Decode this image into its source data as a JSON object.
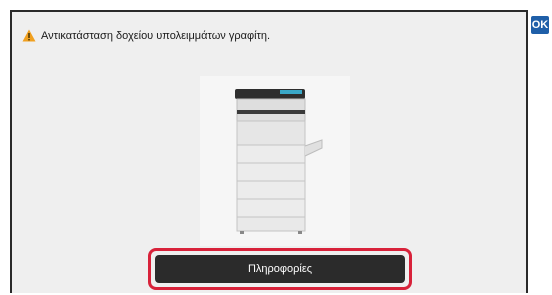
{
  "dialog": {
    "message": "Αντικατάσταση δοχείου υπολειμμάτων γραφίτη.",
    "ok_label": "OK",
    "info_label": "Πληροφορίες"
  },
  "icons": {
    "warning": "warning-triangle-icon",
    "device": "copier-illustration",
    "waste_toner": "waste-toner-box-icon"
  },
  "colors": {
    "ok_button": "#1f5fa8",
    "highlight": "#d8223a",
    "warning": "#f0a020",
    "button_bg": "#2b2b2b"
  }
}
